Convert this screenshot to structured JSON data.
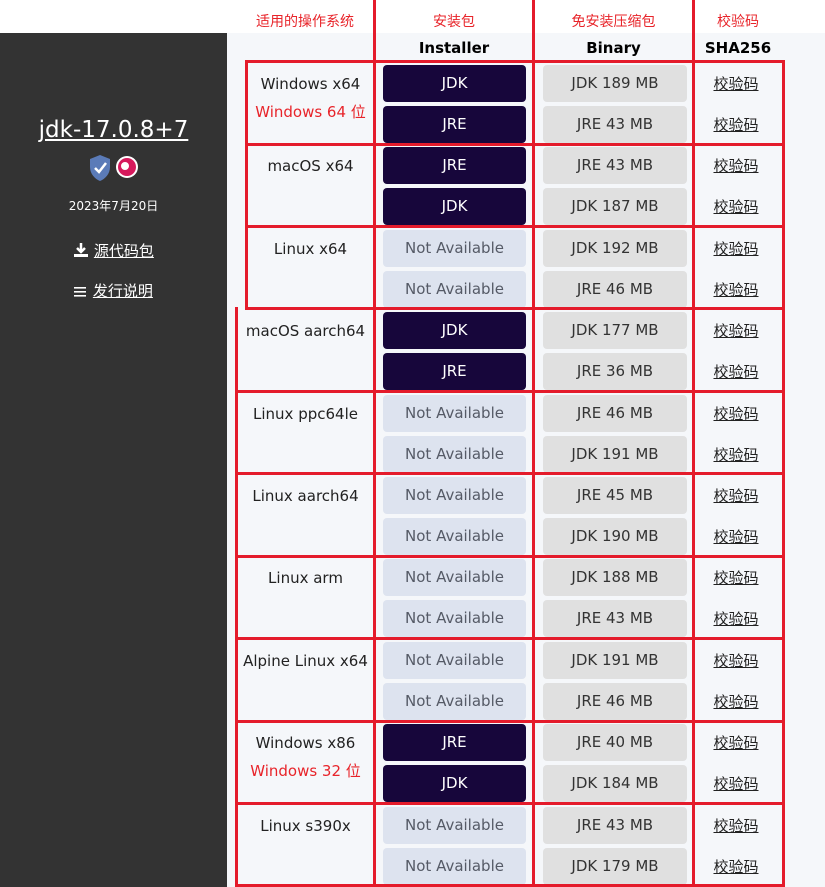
{
  "sidebar": {
    "release": "jdk-17.0.8+7",
    "badges": [
      "shield-check-icon",
      "pink-badge-icon"
    ],
    "date": "2023年7月20日",
    "source_link": "源代码包",
    "notes_link": "发行说明"
  },
  "headers": {
    "os_cn": "适用的操作系统",
    "installer_cn": "安装包",
    "installer_en": "Installer",
    "binary_cn": "免安装压缩包",
    "binary_en": "Binary",
    "checksum_cn": "校验码",
    "checksum_en": "SHA256"
  },
  "rows": [
    {
      "os": "Windows x64",
      "sub": "Windows 64 位",
      "installer": [
        "JDK",
        "JRE"
      ],
      "binary": [
        "JDK 189 MB",
        "JRE 43 MB"
      ],
      "sha": [
        "校验码",
        "校验码"
      ]
    },
    {
      "os": "macOS x64",
      "sub": "",
      "installer": [
        "JRE",
        "JDK"
      ],
      "binary": [
        "JRE 43 MB",
        "JDK 187 MB"
      ],
      "sha": [
        "校验码",
        "校验码"
      ]
    },
    {
      "os": "Linux x64",
      "sub": "",
      "installer": [
        "Not Available",
        "Not Available"
      ],
      "binary": [
        "JDK 192 MB",
        "JRE 46 MB"
      ],
      "sha": [
        "校验码",
        "校验码"
      ]
    },
    {
      "os": "macOS aarch64",
      "sub": "",
      "installer": [
        "JDK",
        "JRE"
      ],
      "binary": [
        "JDK 177 MB",
        "JRE 36 MB"
      ],
      "sha": [
        "校验码",
        "校验码"
      ]
    },
    {
      "os": "Linux ppc64le",
      "sub": "",
      "installer": [
        "Not Available",
        "Not Available"
      ],
      "binary": [
        "JRE 46 MB",
        "JDK 191 MB"
      ],
      "sha": [
        "校验码",
        "校验码"
      ]
    },
    {
      "os": "Linux aarch64",
      "sub": "",
      "installer": [
        "Not Available",
        "Not Available"
      ],
      "binary": [
        "JRE 45 MB",
        "JDK 190 MB"
      ],
      "sha": [
        "校验码",
        "校验码"
      ]
    },
    {
      "os": "Linux arm",
      "sub": "",
      "installer": [
        "Not Available",
        "Not Available"
      ],
      "binary": [
        "JDK 188 MB",
        "JRE 43 MB"
      ],
      "sha": [
        "校验码",
        "校验码"
      ]
    },
    {
      "os": "Alpine Linux x64",
      "sub": "",
      "installer": [
        "Not Available",
        "Not Available"
      ],
      "binary": [
        "JDK 191 MB",
        "JRE 46 MB"
      ],
      "sha": [
        "校验码",
        "校验码"
      ]
    },
    {
      "os": "Windows x86",
      "sub": "Windows 32 位",
      "installer": [
        "JRE",
        "JDK"
      ],
      "binary": [
        "JRE 40 MB",
        "JDK 184 MB"
      ],
      "sha": [
        "校验码",
        "校验码"
      ]
    },
    {
      "os": "Linux s390x",
      "sub": "",
      "installer": [
        "Not Available",
        "Not Available"
      ],
      "binary": [
        "JRE 43 MB",
        "JDK 179 MB"
      ],
      "sha": [
        "校验码",
        "校验码"
      ]
    }
  ],
  "colors": {
    "annotation_red": "#e41b2b",
    "button_dark": "#17063b",
    "button_na": "#dde3ef",
    "button_binary": "#e0e0e0",
    "sidebar_bg": "#333333"
  }
}
